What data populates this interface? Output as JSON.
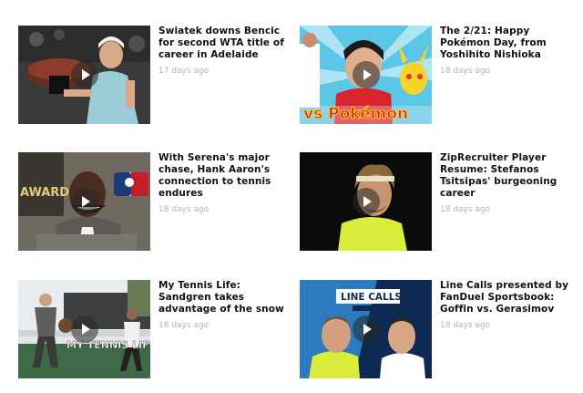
{
  "videos": [
    {
      "title": "Swiatek downs Bencic for second WTA title of career in Adelaide",
      "age": "17 days ago",
      "thumb_icon": "swiatek-trophy-thumbnail"
    },
    {
      "title": "The 2/21: Happy Pokémon Day, from Yoshihito Nishioka",
      "age": "18 days ago",
      "thumb_icon": "nishioka-pokemon-thumbnail",
      "thumb_text": "vs Pokémon"
    },
    {
      "title": "With Serena's major chase, Hank Aaron's connection to tennis endures",
      "age": "18 days ago",
      "thumb_icon": "hank-aaron-thumbnail",
      "thumb_text": "AWARD"
    },
    {
      "title": "ZipRecruiter Player Resume: Stefanos Tsitsipas' burgeoning career",
      "age": "18 days ago",
      "thumb_icon": "tsitsipas-thumbnail"
    },
    {
      "title": "My Tennis Life: Sandgren takes advantage of the snow",
      "age": "18 days ago",
      "thumb_icon": "sandgren-training-thumbnail",
      "thumb_text": "MY TENNIS LIFE"
    },
    {
      "title": "Line Calls presented by FanDuel Sportsbook: Goffin vs. Gerasimov",
      "age": "18 days ago",
      "thumb_icon": "line-calls-thumbnail",
      "thumb_text": "LINE CALLS"
    }
  ],
  "colors": {
    "title": "#111111",
    "date": "#b3b3b3",
    "play_overlay": "rgba(40,40,40,0.55)"
  }
}
